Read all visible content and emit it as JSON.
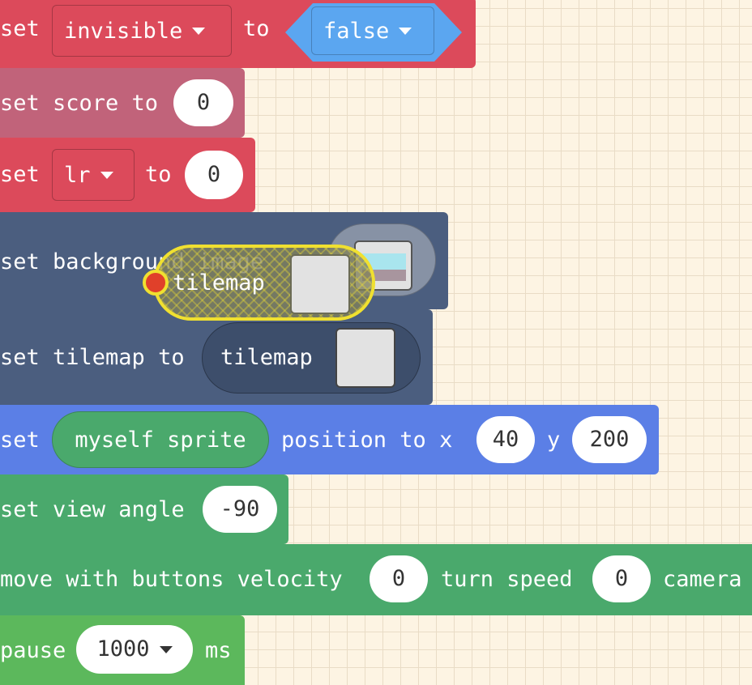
{
  "blocks": {
    "set_invisible": {
      "set": "set",
      "var": "invisible",
      "to": "to",
      "value": "false"
    },
    "set_score": {
      "set": "set score to",
      "value": "0"
    },
    "set_lr": {
      "set": "set",
      "var": "lr",
      "to": "to",
      "value": "0"
    },
    "set_background": {
      "label": "set background image"
    },
    "dragged_tilemap": {
      "label": "tilemap"
    },
    "set_tilemap": {
      "label": "set tilemap to",
      "arg": "tilemap"
    },
    "set_position": {
      "set": "set",
      "sprite": "myself sprite",
      "label": "position to x",
      "x": "40",
      "y_label": "y",
      "y": "200"
    },
    "set_view_angle": {
      "label": "set view angle",
      "value": "-90"
    },
    "move_with_buttons": {
      "label": "move with buttons velocity",
      "velocity": "0",
      "turn_label": "turn speed",
      "turn": "0",
      "camera_label": "camera"
    },
    "pause": {
      "label": "pause",
      "value": "1000",
      "unit": "ms"
    }
  },
  "colors": {
    "workspace": "#fdf4e3",
    "variables_red": "#dc4a5b",
    "score_pink": "#c1637a",
    "scene_slate": "#4b5e7f",
    "sprites_blue": "#5b7fe6",
    "game_green": "#4aa96c",
    "loops_green": "#5cb85c",
    "boolean_blue": "#5ba6f0",
    "highlight_yellow": "#f0e030"
  }
}
